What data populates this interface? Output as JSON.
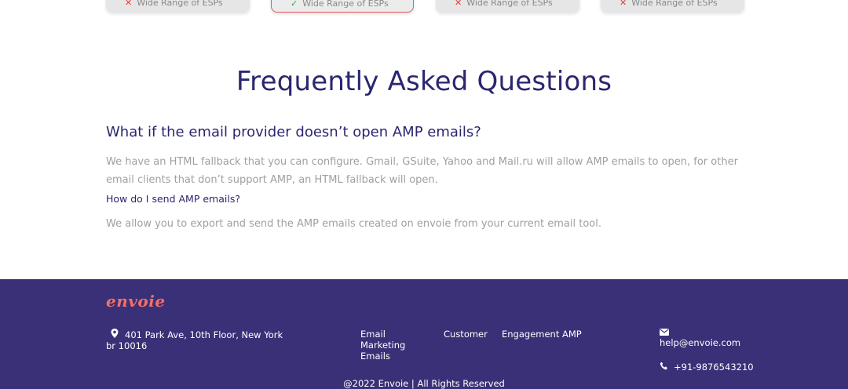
{
  "plans": [
    {
      "feature": "Wide Range of ESPs",
      "included": false,
      "highlighted": false
    },
    {
      "feature": "Wide Range of ESPs",
      "included": true,
      "highlighted": true
    },
    {
      "feature": "Wide Range of ESPs",
      "included": false,
      "highlighted": false
    },
    {
      "feature": "Wide Range of ESPs",
      "included": false,
      "highlighted": false
    }
  ],
  "faq": {
    "title": "Frequently Asked Questions",
    "items": [
      {
        "question": "What if the email provider doesn’t open AMP emails?",
        "answer": "We have an HTML fallback that you can configure. Gmail, GSuite, Yahoo and Mail.ru will allow AMP emails to open, for other email clients that don’t support AMP, an HTML fallback will open."
      },
      {
        "question": "How do I send AMP emails?",
        "answer": "We allow you to export and send the AMP emails created on envoie from your current email tool."
      }
    ]
  },
  "footer": {
    "logo": "envoie",
    "address": "401 Park Ave, 10th Floor, New York br 10016",
    "links": [
      "Email Marketing Emails",
      "Customer",
      "Engagement AMP"
    ],
    "email": "help@envoie.com",
    "phone": "+91-9876543210",
    "copyright": "@2022 Envoie | All Rights Reserved"
  },
  "colors": {
    "heading": "#2b2670",
    "muted_text": "#a0a0a0",
    "footer_bg": "#3a3077",
    "logo": "#f0706a",
    "cross": "#e23c3c",
    "check": "#3aa54a",
    "highlight_border": "#e55a5a"
  },
  "icons": {
    "cross": "cross-icon",
    "check": "check-icon",
    "location": "location-pin-icon",
    "email": "envelope-icon",
    "phone": "phone-icon"
  }
}
